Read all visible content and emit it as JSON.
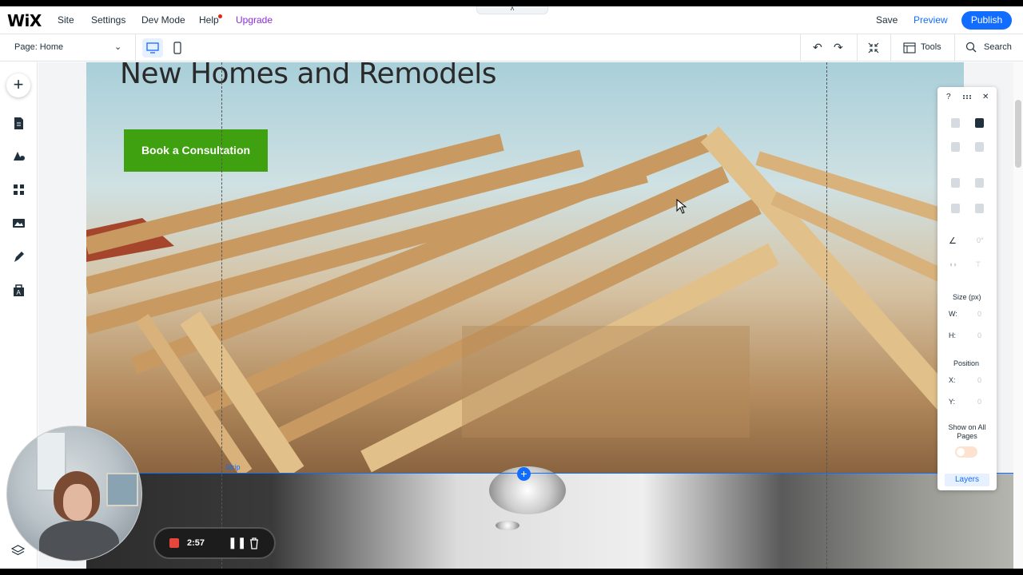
{
  "topbar": {
    "logo": "WiX",
    "menu": [
      "Site",
      "Settings",
      "Dev Mode",
      "Help",
      "Upgrade"
    ],
    "handle": "˄",
    "save": "Save",
    "preview": "Preview",
    "publish": "Publish"
  },
  "pagebar": {
    "page": "Page: Home",
    "tools": "Tools",
    "search": "Search"
  },
  "hero": {
    "title": "New Homes and Remodels",
    "cta": "Book a Consultation",
    "strip_label": "Strip"
  },
  "inspector": {
    "help": "?",
    "rotation": "0°",
    "size_label": "Size (px)",
    "w_label": "W:",
    "w_value": "0",
    "h_label": "H:",
    "h_value": "0",
    "position_label": "Position",
    "x_label": "X:",
    "x_value": "0",
    "y_label": "Y:",
    "y_value": "0",
    "show_all": "Show on All Pages",
    "layers": "Layers"
  },
  "recorder": {
    "time": "2:57"
  },
  "colors": {
    "accent": "#116dff",
    "cta": "#3fa010",
    "upgrade": "#8c2dd8"
  }
}
